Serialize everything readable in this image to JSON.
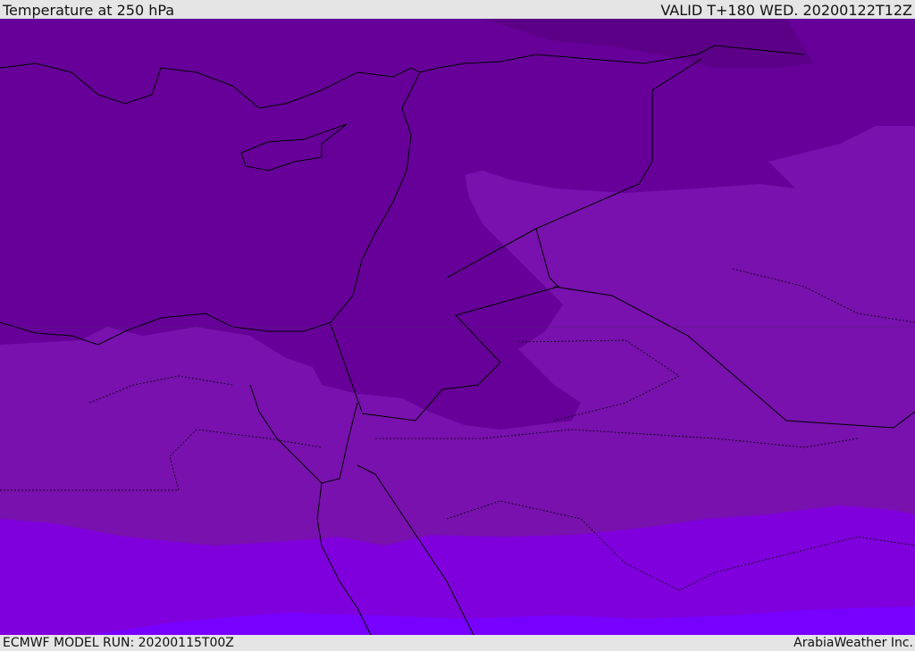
{
  "header": {
    "title": "Temperature at 250 hPa",
    "valid": "VALID T+180 WED. 20200122T12Z"
  },
  "footer": {
    "model_run": "ECMWF MODEL RUN: 20200115T00Z",
    "credit": "ArabiaWeather Inc."
  },
  "colors": {
    "band_darkest": "#5c0088",
    "band_dark": "#660099",
    "band_mid": "#7811ad",
    "band_light": "#8000dd",
    "band_lightest": "#7700ff"
  }
}
